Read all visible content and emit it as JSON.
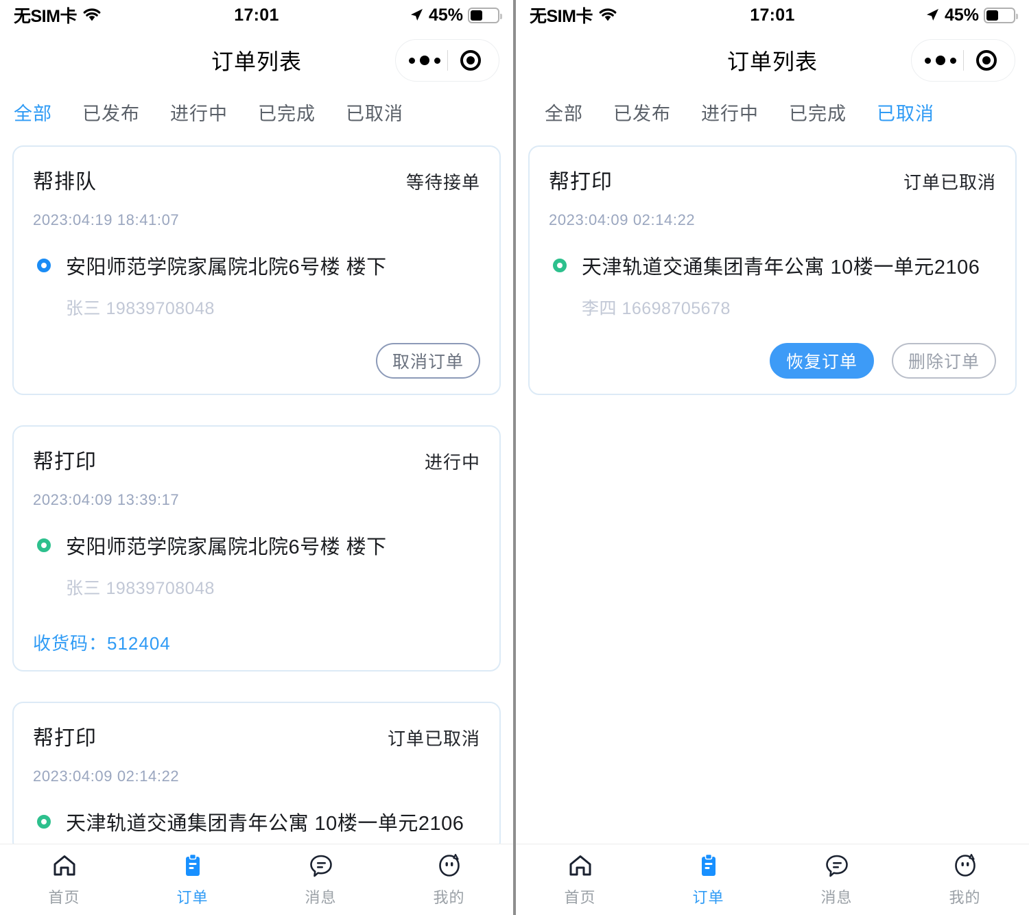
{
  "statusbar": {
    "carrier": "无SIM卡",
    "time": "17:01",
    "battery_percent": "45%",
    "wifi_icon": "wifi-icon",
    "location_icon": "location-arrow-icon",
    "battery_icon": "battery-icon"
  },
  "navbar": {
    "title": "订单列表",
    "capsule_more_icon": "more-dots-icon",
    "capsule_target_icon": "target-circle-icon"
  },
  "colors": {
    "accent_blue": "#2f9bf5",
    "primary_button": "#3d9bf7",
    "dot_blue": "#1a8cf5",
    "dot_green": "#2dc08d",
    "card_border": "#dceaf6",
    "muted_text": "#9aa6bf",
    "contact_text": "#c2c8d6"
  },
  "left_panel": {
    "tabs": [
      {
        "label": "全部",
        "active": true
      },
      {
        "label": "已发布",
        "active": false
      },
      {
        "label": "进行中",
        "active": false
      },
      {
        "label": "已完成",
        "active": false
      },
      {
        "label": "已取消",
        "active": false
      }
    ],
    "orders": [
      {
        "type": "帮排队",
        "status": "等待接单",
        "time": "2023:04:19 18:41:07",
        "dot_color": "blue",
        "address": "安阳师范学院家属院北院6号楼 楼下",
        "contact": "张三 19839708048",
        "pickup_code": null,
        "buttons": [
          {
            "label": "取消订单",
            "style": "outline"
          }
        ]
      },
      {
        "type": "帮打印",
        "status": "进行中",
        "time": "2023:04:09 13:39:17",
        "dot_color": "green",
        "address": "安阳师范学院家属院北院6号楼 楼下",
        "contact": "张三 19839708048",
        "pickup_code": "收货码：512404",
        "buttons": []
      },
      {
        "type": "帮打印",
        "status": "订单已取消",
        "time": "2023:04:09 02:14:22",
        "dot_color": "green",
        "address": "天津轨道交通集团青年公寓 10楼一单元2106",
        "contact": null,
        "pickup_code": null,
        "buttons": []
      }
    ]
  },
  "right_panel": {
    "tabs": [
      {
        "label": "全部",
        "active": false
      },
      {
        "label": "已发布",
        "active": false
      },
      {
        "label": "进行中",
        "active": false
      },
      {
        "label": "已完成",
        "active": false
      },
      {
        "label": "已取消",
        "active": true
      }
    ],
    "orders": [
      {
        "type": "帮打印",
        "status": "订单已取消",
        "time": "2023:04:09 02:14:22",
        "dot_color": "green",
        "address": "天津轨道交通集团青年公寓 10楼一单元2106",
        "contact": "李四 16698705678",
        "pickup_code": null,
        "buttons": [
          {
            "label": "恢复订单",
            "style": "primary"
          },
          {
            "label": "删除订单",
            "style": "outline-gray"
          }
        ]
      }
    ]
  },
  "tabbar": {
    "items": [
      {
        "label": "首页",
        "icon": "home-icon",
        "active": false
      },
      {
        "label": "订单",
        "icon": "clipboard-icon",
        "active": true
      },
      {
        "label": "消息",
        "icon": "chat-bubble-icon",
        "active": false
      },
      {
        "label": "我的",
        "icon": "profile-face-icon",
        "active": false
      }
    ]
  }
}
